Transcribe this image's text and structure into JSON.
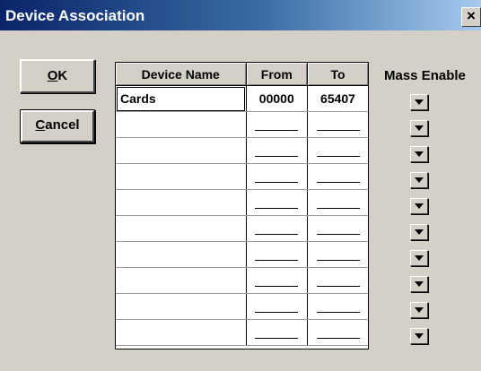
{
  "window": {
    "title": "Device Association",
    "close_glyph": "×"
  },
  "buttons": {
    "ok_label": "OK",
    "ok_mnemonic": "O",
    "cancel_label": "Cancel",
    "cancel_mnemonic": "C"
  },
  "grid": {
    "columns": [
      "Device Name",
      "From",
      "To"
    ],
    "rows": [
      {
        "device_name": "Cards",
        "from": "00000",
        "to": "65407"
      },
      {
        "device_name": "",
        "from": "",
        "to": ""
      },
      {
        "device_name": "",
        "from": "",
        "to": ""
      },
      {
        "device_name": "",
        "from": "",
        "to": ""
      },
      {
        "device_name": "",
        "from": "",
        "to": ""
      },
      {
        "device_name": "",
        "from": "",
        "to": ""
      },
      {
        "device_name": "",
        "from": "",
        "to": ""
      },
      {
        "device_name": "",
        "from": "",
        "to": ""
      },
      {
        "device_name": "",
        "from": "",
        "to": ""
      },
      {
        "device_name": "",
        "from": "",
        "to": ""
      }
    ]
  },
  "mass_enable": {
    "label": "Mass Enable",
    "dropdown_icon": "dropdown-arrow-icon",
    "count": 10
  },
  "colors": {
    "dialog_bg": "#d4d0c8",
    "titlebar": "#0a246a"
  }
}
